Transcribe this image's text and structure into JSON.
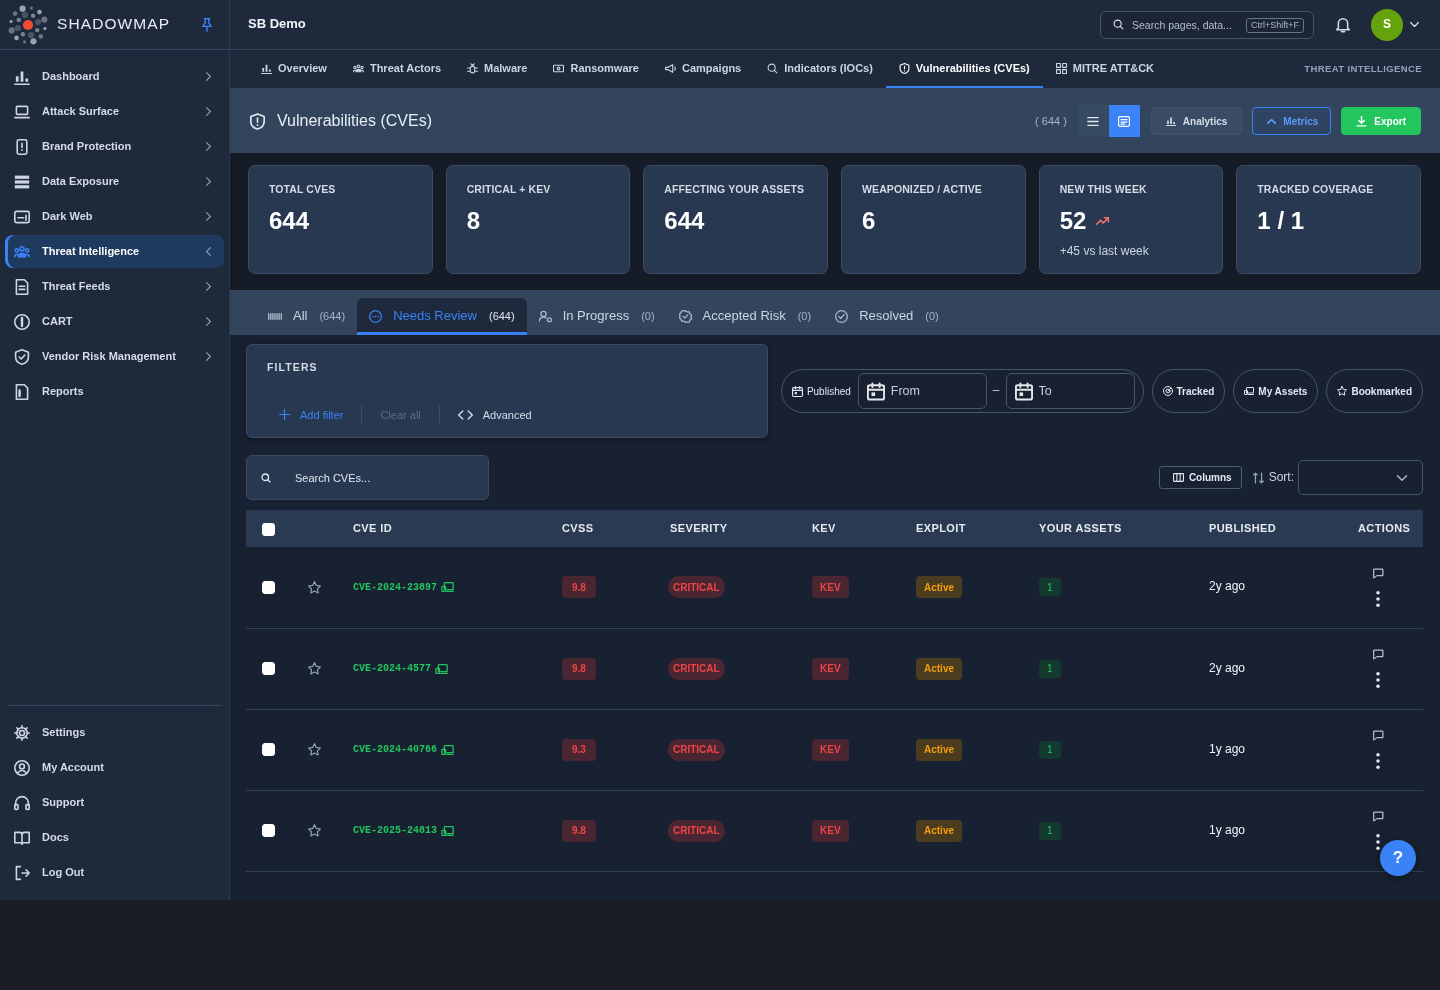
{
  "sidebar": {
    "brand": "SHADOWMAP",
    "items": [
      {
        "label": "Dashboard",
        "selected": false,
        "expanded": false
      },
      {
        "label": "Attack Surface",
        "selected": false,
        "expanded": false
      },
      {
        "label": "Brand Protection",
        "selected": false,
        "expanded": false
      },
      {
        "label": "Data Exposure",
        "selected": false,
        "expanded": false
      },
      {
        "label": "Dark Web",
        "selected": false,
        "expanded": false
      },
      {
        "label": "Threat Intelligence",
        "selected": true,
        "expanded": true
      },
      {
        "label": "Threat Feeds",
        "selected": false,
        "expanded": false
      },
      {
        "label": "CART",
        "selected": false,
        "expanded": false
      },
      {
        "label": "Vendor Risk Management",
        "selected": false,
        "expanded": false
      },
      {
        "label": "Reports",
        "selected": false
      }
    ],
    "footer_items": [
      "Settings",
      "My Account",
      "Support",
      "Docs",
      "Log Out"
    ]
  },
  "top_bar": {
    "workspace": "SB Demo",
    "search": {
      "placeholder": "Search pages, data...",
      "shortcut": "Ctrl+Shift+F"
    },
    "avatar_initial": "S"
  },
  "section_tabs": [
    {
      "label": "Overview",
      "selected": false
    },
    {
      "label": "Threat Actors",
      "selected": false
    },
    {
      "label": "Malware",
      "selected": false
    },
    {
      "label": "Ransomware",
      "selected": false
    },
    {
      "label": "Campaigns",
      "selected": false
    },
    {
      "label": "Indicators (IOCs)",
      "selected": false
    },
    {
      "label": "Vulnerabilities (CVEs)",
      "selected": true
    },
    {
      "label": "MITRE ATT&CK",
      "selected": false
    }
  ],
  "section_label": "THREAT INTELLIGENCE",
  "page_header": {
    "title": "Vulnerabilities (CVEs)",
    "count": "( 644 )",
    "views": [
      {
        "selected": false
      },
      {
        "selected": true
      }
    ],
    "analytics_button": "Analytics",
    "metrics_button": {
      "label": "Metrics",
      "expanded": true
    },
    "export_button": "Export"
  },
  "metrics": [
    {
      "label": "TOTAL CVES",
      "value": "644"
    },
    {
      "label": "CRITICAL + KEV",
      "value": "8"
    },
    {
      "label": "AFFECTING YOUR ASSETS",
      "value": "644"
    },
    {
      "label": "WEAPONIZED / ACTIVE",
      "value": "6"
    },
    {
      "label": "NEW THIS WEEK",
      "value": "52",
      "trending_up": true,
      "note": "+45 vs last week"
    },
    {
      "label": "TRACKED COVERAGE",
      "value": "1 / 1"
    }
  ],
  "status_tabs": [
    {
      "label": "All",
      "count": "(644)",
      "selected": false
    },
    {
      "label": "Needs Review",
      "count": "(644)",
      "selected": true
    },
    {
      "label": "In Progress",
      "count": "(0)",
      "selected": false
    },
    {
      "label": "Accepted Risk",
      "count": "(0)",
      "selected": false
    },
    {
      "label": "Resolved",
      "count": "(0)",
      "selected": false
    }
  ],
  "filters": {
    "title": "FILTERS",
    "add_button": "Add filter",
    "clear_button": {
      "label": "Clear all",
      "disabled": true
    },
    "advanced_button": "Advanced"
  },
  "date_filter": {
    "label": "Published",
    "from": {
      "placeholder": "From"
    },
    "separator": "–",
    "to": {
      "placeholder": "To"
    }
  },
  "quick_filters": [
    {
      "label": "Tracked",
      "selected": false
    },
    {
      "label": "My Assets",
      "selected": false
    },
    {
      "label": "Bookmarked",
      "selected": false
    }
  ],
  "search": {
    "placeholder": "Search CVEs..."
  },
  "columns_button": "Columns",
  "sort": {
    "label": "Sort:"
  },
  "table": {
    "select_all": {
      "checked": false
    },
    "columns": [
      "CVE ID",
      "CVSS",
      "SEVERITY",
      "KEV",
      "EXPLOIT",
      "YOUR ASSETS",
      "PUBLISHED",
      "ACTIONS"
    ],
    "rows": [
      {
        "checked": false,
        "bookmarked": false,
        "cve_id": "CVE-2024-23897",
        "cvss": "9.8",
        "severity": "CRITICAL",
        "kev": "KEV",
        "exploit": "Active",
        "assets": "1",
        "published": "2y ago"
      },
      {
        "checked": false,
        "bookmarked": false,
        "cve_id": "CVE-2024-4577",
        "cvss": "9.8",
        "severity": "CRITICAL",
        "kev": "KEV",
        "exploit": "Active",
        "assets": "1",
        "published": "2y ago"
      },
      {
        "checked": false,
        "bookmarked": false,
        "cve_id": "CVE-2024-40766",
        "cvss": "9.3",
        "severity": "CRITICAL",
        "kev": "KEV",
        "exploit": "Active",
        "assets": "1",
        "published": "1y ago"
      },
      {
        "checked": false,
        "bookmarked": false,
        "cve_id": "CVE-2025-24813",
        "cvss": "9.8",
        "severity": "CRITICAL",
        "kev": "KEV",
        "exploit": "Active",
        "assets": "1",
        "published": "1y ago"
      }
    ]
  },
  "help_button": "?"
}
